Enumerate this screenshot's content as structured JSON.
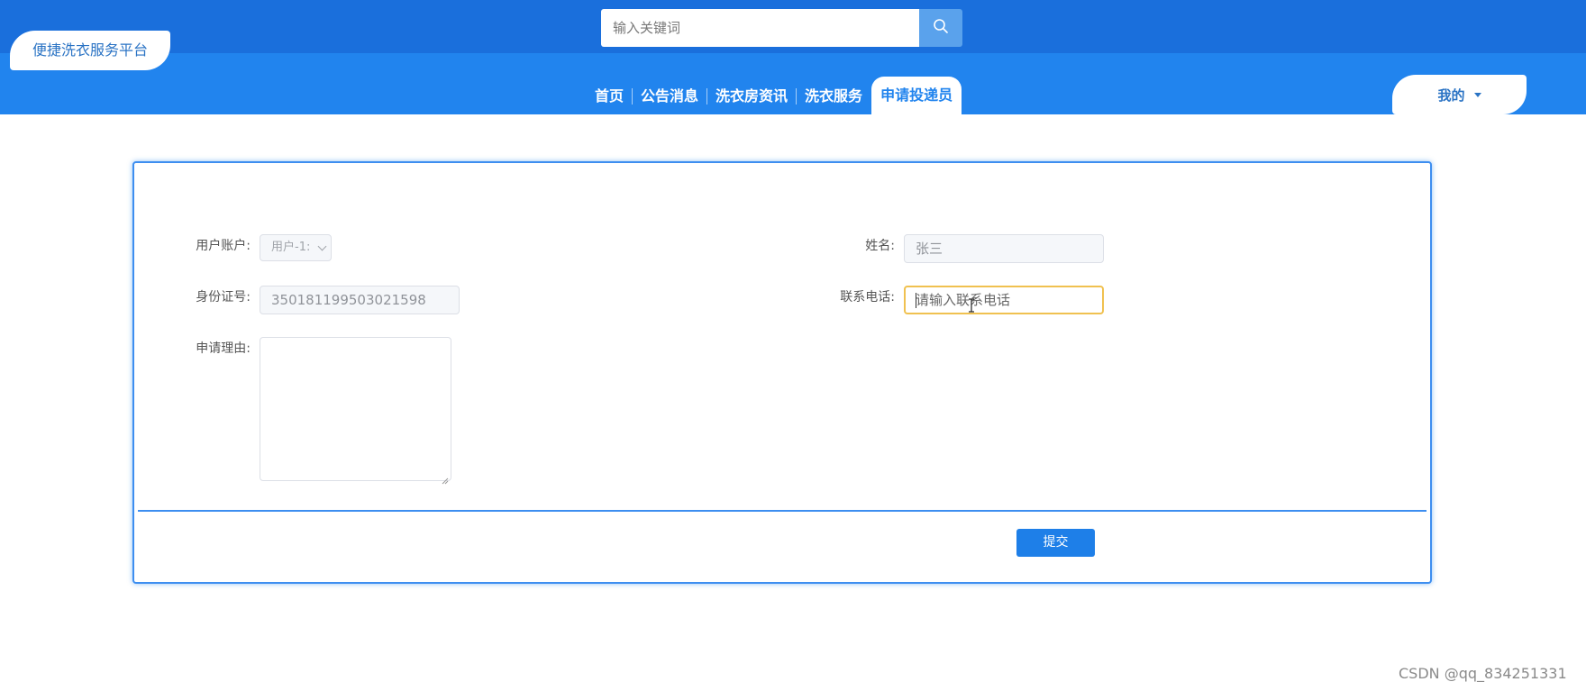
{
  "header": {
    "logo_text": "便捷洗衣服务平台",
    "search": {
      "placeholder": "输入关键词",
      "value": ""
    },
    "search_icon": "search-icon",
    "nav": [
      {
        "label": "首页",
        "active": false
      },
      {
        "label": "公告消息",
        "active": false
      },
      {
        "label": "洗衣房资讯",
        "active": false
      },
      {
        "label": "洗衣服务",
        "active": false
      },
      {
        "label": "申请投递员",
        "active": true
      }
    ],
    "user_menu": {
      "label": "我的",
      "icon": "caret-down-icon"
    }
  },
  "form": {
    "user_account": {
      "label": "用户账户:",
      "value": "用户-1:"
    },
    "name": {
      "label": "姓名:",
      "value": "张三"
    },
    "id_number": {
      "label": "身份证号:",
      "value": "350181199503021598"
    },
    "phone": {
      "label": "联系电话:",
      "placeholder": "请输入联系电话",
      "value": ""
    },
    "reason": {
      "label": "申请理由:",
      "value": ""
    },
    "submit_label": "提交"
  },
  "watermark": "CSDN @qq_834251331",
  "colors": {
    "header_top": "#1a6fdc",
    "header_bottom": "#2184ee",
    "accent": "#1e7fe8",
    "focus_border": "#f0c150"
  }
}
